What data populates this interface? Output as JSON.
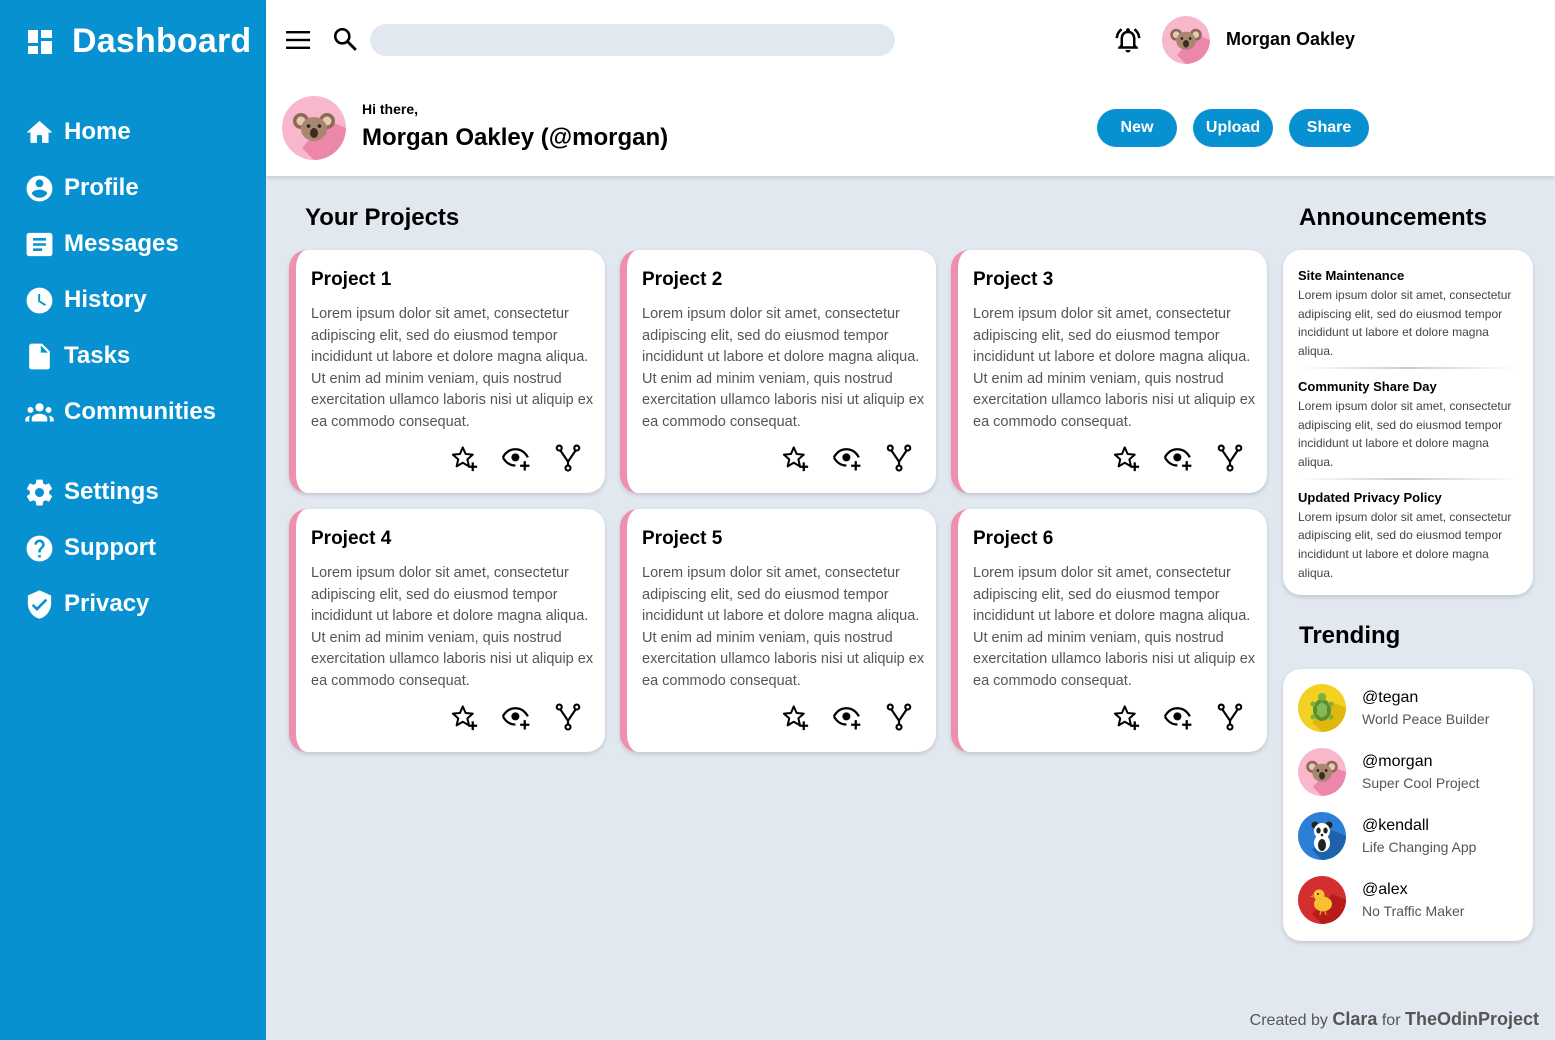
{
  "sidebar": {
    "brand": "Dashboard",
    "items": [
      {
        "label": "Home",
        "icon": "home-icon"
      },
      {
        "label": "Profile",
        "icon": "account-circle-icon"
      },
      {
        "label": "Messages",
        "icon": "messages-icon"
      },
      {
        "label": "History",
        "icon": "clock-icon"
      },
      {
        "label": "Tasks",
        "icon": "file-icon"
      },
      {
        "label": "Communities",
        "icon": "people-icon"
      },
      {
        "label": "Settings",
        "icon": "gear-icon"
      },
      {
        "label": "Support",
        "icon": "help-circle-icon"
      },
      {
        "label": "Privacy",
        "icon": "shield-check-icon"
      }
    ]
  },
  "header": {
    "search": {
      "value": "",
      "placeholder": ""
    },
    "user_name": "Morgan Oakley",
    "greeting": "Hi there,",
    "hero_name": "Morgan Oakley (@morgan)",
    "buttons": {
      "new": "New",
      "upload": "Upload",
      "share": "Share"
    }
  },
  "projects": {
    "title": "Your Projects",
    "items": [
      {
        "title": "Project 1",
        "body": "Lorem ipsum dolor sit amet, consectetur adipiscing elit, sed do eiusmod tempor incididunt ut labore et dolore magna aliqua. Ut enim ad minim veniam, quis nostrud exercitation ullamco laboris nisi ut aliquip ex ea commodo consequat."
      },
      {
        "title": "Project 2",
        "body": "Lorem ipsum dolor sit amet, consectetur adipiscing elit, sed do eiusmod tempor incididunt ut labore et dolore magna aliqua. Ut enim ad minim veniam, quis nostrud exercitation ullamco laboris nisi ut aliquip ex ea commodo consequat."
      },
      {
        "title": "Project 3",
        "body": "Lorem ipsum dolor sit amet, consectetur adipiscing elit, sed do eiusmod tempor incididunt ut labore et dolore magna aliqua. Ut enim ad minim veniam, quis nostrud exercitation ullamco laboris nisi ut aliquip ex ea commodo consequat."
      },
      {
        "title": "Project 4",
        "body": "Lorem ipsum dolor sit amet, consectetur adipiscing elit, sed do eiusmod tempor incididunt ut labore et dolore magna aliqua. Ut enim ad minim veniam, quis nostrud exercitation ullamco laboris nisi ut aliquip ex ea commodo consequat."
      },
      {
        "title": "Project 5",
        "body": "Lorem ipsum dolor sit amet, consectetur adipiscing elit, sed do eiusmod tempor incididunt ut labore et dolore magna aliqua. Ut enim ad minim veniam, quis nostrud exercitation ullamco laboris nisi ut aliquip ex ea commodo consequat."
      },
      {
        "title": "Project 6",
        "body": "Lorem ipsum dolor sit amet, consectetur adipiscing elit, sed do eiusmod tempor incididunt ut labore et dolore magna aliqua. Ut enim ad minim veniam, quis nostrud exercitation ullamco laboris nisi ut aliquip ex ea commodo consequat."
      }
    ]
  },
  "announcements": {
    "title": "Announcements",
    "items": [
      {
        "title": "Site Maintenance",
        "body": "Lorem ipsum dolor sit amet, consectetur adipiscing elit, sed do eiusmod tempor incididunt ut labore et dolore magna aliqua."
      },
      {
        "title": "Community Share Day",
        "body": "Lorem ipsum dolor sit amet, consectetur adipiscing elit, sed do eiusmod tempor incididunt ut labore et dolore magna aliqua."
      },
      {
        "title": "Updated Privacy Policy",
        "body": "Lorem ipsum dolor sit amet, consectetur adipiscing elit, sed do eiusmod tempor incididunt ut labore et dolore magna aliqua."
      }
    ]
  },
  "trending": {
    "title": "Trending",
    "items": [
      {
        "handle": "@tegan",
        "desc": "World Peace Builder",
        "avatar": "turtle-icon",
        "color": "#f3d122"
      },
      {
        "handle": "@morgan",
        "desc": "Super Cool Project",
        "avatar": "koala-icon",
        "color": "#f9b7cc"
      },
      {
        "handle": "@kendall",
        "desc": "Life Changing App",
        "avatar": "panda-icon",
        "color": "#2b7fd6"
      },
      {
        "handle": "@alex",
        "desc": "No Traffic Maker",
        "avatar": "chick-icon",
        "color": "#d32f2f"
      }
    ]
  },
  "footer": {
    "prefix": "Created by",
    "author": "Clara",
    "middle": "for",
    "org": "TheOdinProject"
  },
  "colors": {
    "accent": "#0891d1",
    "card_border": "#ee8fae",
    "background": "#e2e8f0"
  }
}
